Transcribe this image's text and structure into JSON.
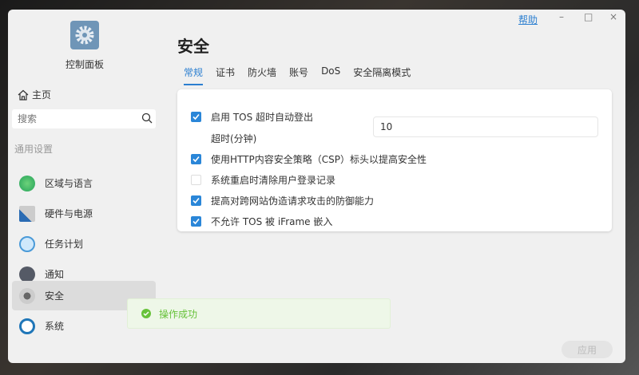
{
  "window": {
    "help": "帮助",
    "min": "–",
    "max": "□",
    "close": "×"
  },
  "sidebar": {
    "app_title": "控制面板",
    "home": "主页",
    "search_placeholder": "搜索",
    "section": "通用设置",
    "items": [
      {
        "label": "区域与语言"
      },
      {
        "label": "硬件与电源"
      },
      {
        "label": "任务计划"
      },
      {
        "label": "通知"
      },
      {
        "label": "安全"
      },
      {
        "label": "系统"
      }
    ]
  },
  "main": {
    "title": "安全",
    "tabs": [
      "常规",
      "证书",
      "防火墙",
      "账号",
      "DoS",
      "安全隔离模式"
    ],
    "options": [
      {
        "label": "启用 TOS 超时自动登出",
        "checked": true
      },
      {
        "label": "使用HTTP内容安全策略（CSP）标头以提高安全性",
        "checked": true
      },
      {
        "label": "系统重启时清除用户登录记录",
        "checked": false
      },
      {
        "label": "提高对跨网站伪造请求攻击的防御能力",
        "checked": true
      },
      {
        "label": "不允许 TOS 被 iFrame 嵌入",
        "checked": true
      }
    ],
    "timeout_label": "超时(分钟)",
    "timeout_value": "10",
    "apply": "应用"
  },
  "toast": {
    "message": "操作成功"
  }
}
